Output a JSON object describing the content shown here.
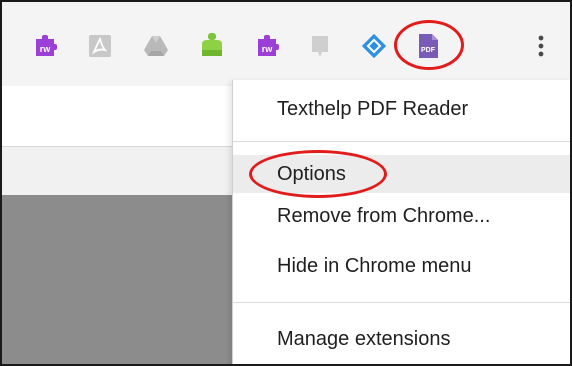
{
  "toolbar": {
    "extensions": [
      {
        "icon": "read-and-write-icon",
        "label": "rw"
      },
      {
        "icon": "adobe-acrobat-icon"
      },
      {
        "icon": "google-drive-icon"
      },
      {
        "icon": "green-extension-icon"
      },
      {
        "icon": "read-and-write-icon",
        "label": "rw"
      },
      {
        "icon": "grey-extension-icon"
      },
      {
        "icon": "blue-diamond-icon"
      },
      {
        "icon": "pdf-reader-icon",
        "label": "PDF"
      }
    ],
    "menu_icon": "more-vert-icon"
  },
  "menu": {
    "title": "Texthelp PDF Reader",
    "items": [
      {
        "label": "Options"
      },
      {
        "label": "Remove from Chrome..."
      },
      {
        "label": "Hide in Chrome menu"
      }
    ],
    "manage": "Manage extensions"
  },
  "colors": {
    "highlight_oval": "#e21b1b",
    "rw_purple": "#9b3fd6",
    "pdf_badge": "#7a5bb7"
  }
}
